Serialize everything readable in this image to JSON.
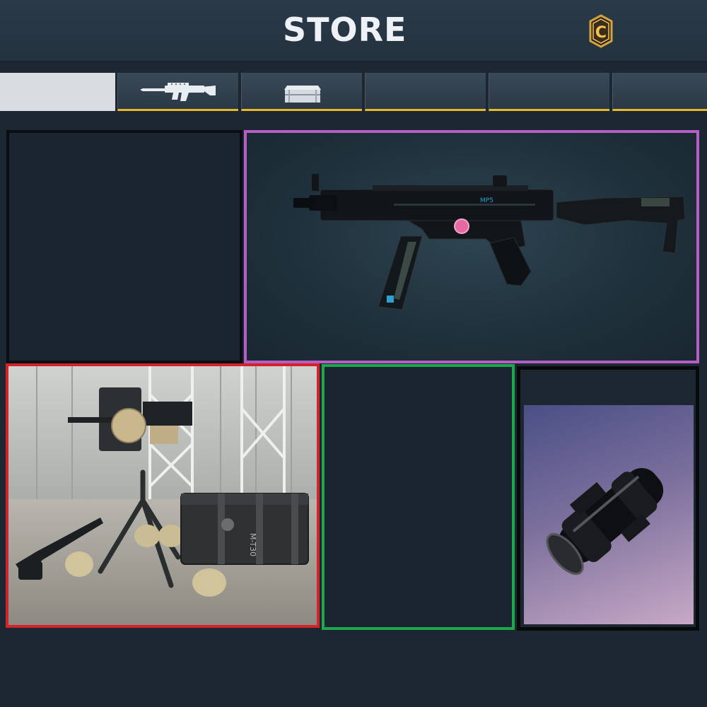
{
  "header": {
    "title": "STORE",
    "currency_icon": "cod-coin-icon",
    "currency_letter": "C"
  },
  "tabs": [
    {
      "id": "featured",
      "icon": "",
      "active": true
    },
    {
      "id": "weapons",
      "icon": "assault-rifle-icon",
      "active": false
    },
    {
      "id": "crates",
      "icon": "crate-icon",
      "active": false
    },
    {
      "id": "tab-4",
      "icon": "",
      "active": false
    },
    {
      "id": "tab-5",
      "icon": "",
      "active": false
    },
    {
      "id": "tab-6",
      "icon": "",
      "active": false
    }
  ],
  "panels": {
    "mp5": {
      "icon": "submachine-gun-icon",
      "border_color": "#b55ec5"
    },
    "sentry": {
      "icon": "sentry-turret-icon",
      "border_color": "#d2232a",
      "case_label": "M-T30"
    },
    "empty": {
      "border_color": "#1fa84b"
    },
    "scope": {
      "icon": "scope-attachment-icon",
      "border_color": "#08090b"
    }
  },
  "colors": {
    "background": "#1c2731",
    "tab_accent": "#e6b82a"
  }
}
